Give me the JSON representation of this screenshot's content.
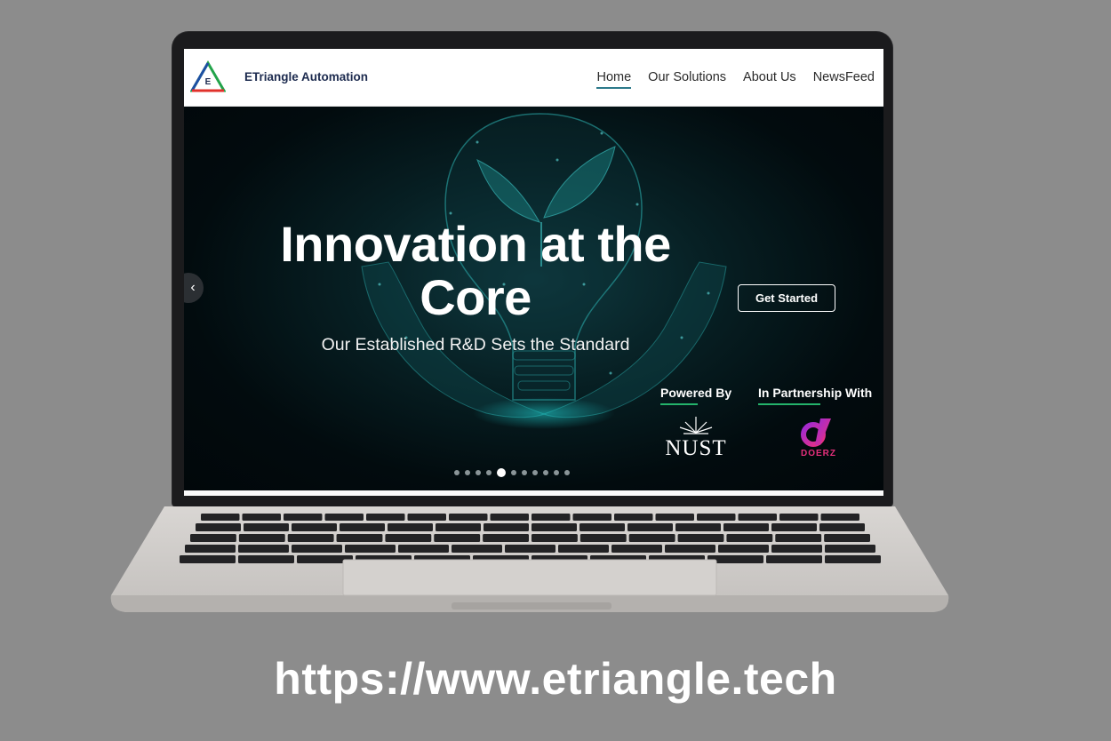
{
  "nav": {
    "brand": "ETriangle Automation",
    "logo_letter": "E",
    "links": [
      {
        "label": "Home",
        "active": true
      },
      {
        "label": "Our Solutions",
        "active": false
      },
      {
        "label": "About Us",
        "active": false
      },
      {
        "label": "NewsFeed",
        "active": false
      }
    ]
  },
  "hero": {
    "title": "Innovation at the Core",
    "subtitle": "Our Established R&D Sets the Standard",
    "cta_label": "Get Started",
    "prev_icon": "chevron-left-icon",
    "powered_by_label": "Powered By",
    "partnership_label": "In Partnership With",
    "powered_by_logo": "NUST",
    "partner_logo": "DOERZ",
    "slides_count": 11,
    "active_slide_index": 4
  },
  "footer": {
    "url": "https://www.etriangle.tech"
  },
  "colors": {
    "accent_teal": "#2c7a8a",
    "underline_green": "#24b36b",
    "partner_pink": "#e62f7c",
    "background": "#8c8c8c"
  }
}
